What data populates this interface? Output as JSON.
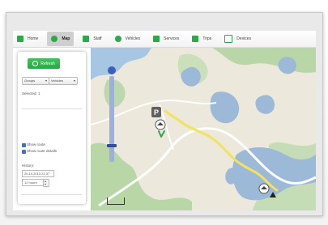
{
  "nav": {
    "items": [
      {
        "label": "Home",
        "icon": "home-icon",
        "active": false
      },
      {
        "label": "Map",
        "icon": "map-icon",
        "active": true
      },
      {
        "label": "Staff",
        "icon": "staff-icon",
        "active": false
      },
      {
        "label": "Vehicles",
        "icon": "vehicle-icon",
        "active": false
      },
      {
        "label": "Services",
        "icon": "tools-icon",
        "active": false
      },
      {
        "label": "Trips",
        "icon": "trips-icon",
        "active": false
      },
      {
        "label": "Devices",
        "icon": "device-icon",
        "active": false
      }
    ]
  },
  "panel": {
    "refresh_label": "Refresh",
    "dropdown_left": "Groups",
    "dropdown_right": "Vehicles",
    "selected": "Selected: 1",
    "show_route": "Show route",
    "show_route_details": "Show route details",
    "history_label": "History:",
    "history_date": "25.10.2013 21:37",
    "history_duration": "12 hours"
  },
  "map": {
    "marker_labels": [
      "P"
    ],
    "colors": {
      "route": "#f1e35a",
      "water": "#9db9d8",
      "forest": "#b8d6a6",
      "road": "#ffffff"
    }
  }
}
